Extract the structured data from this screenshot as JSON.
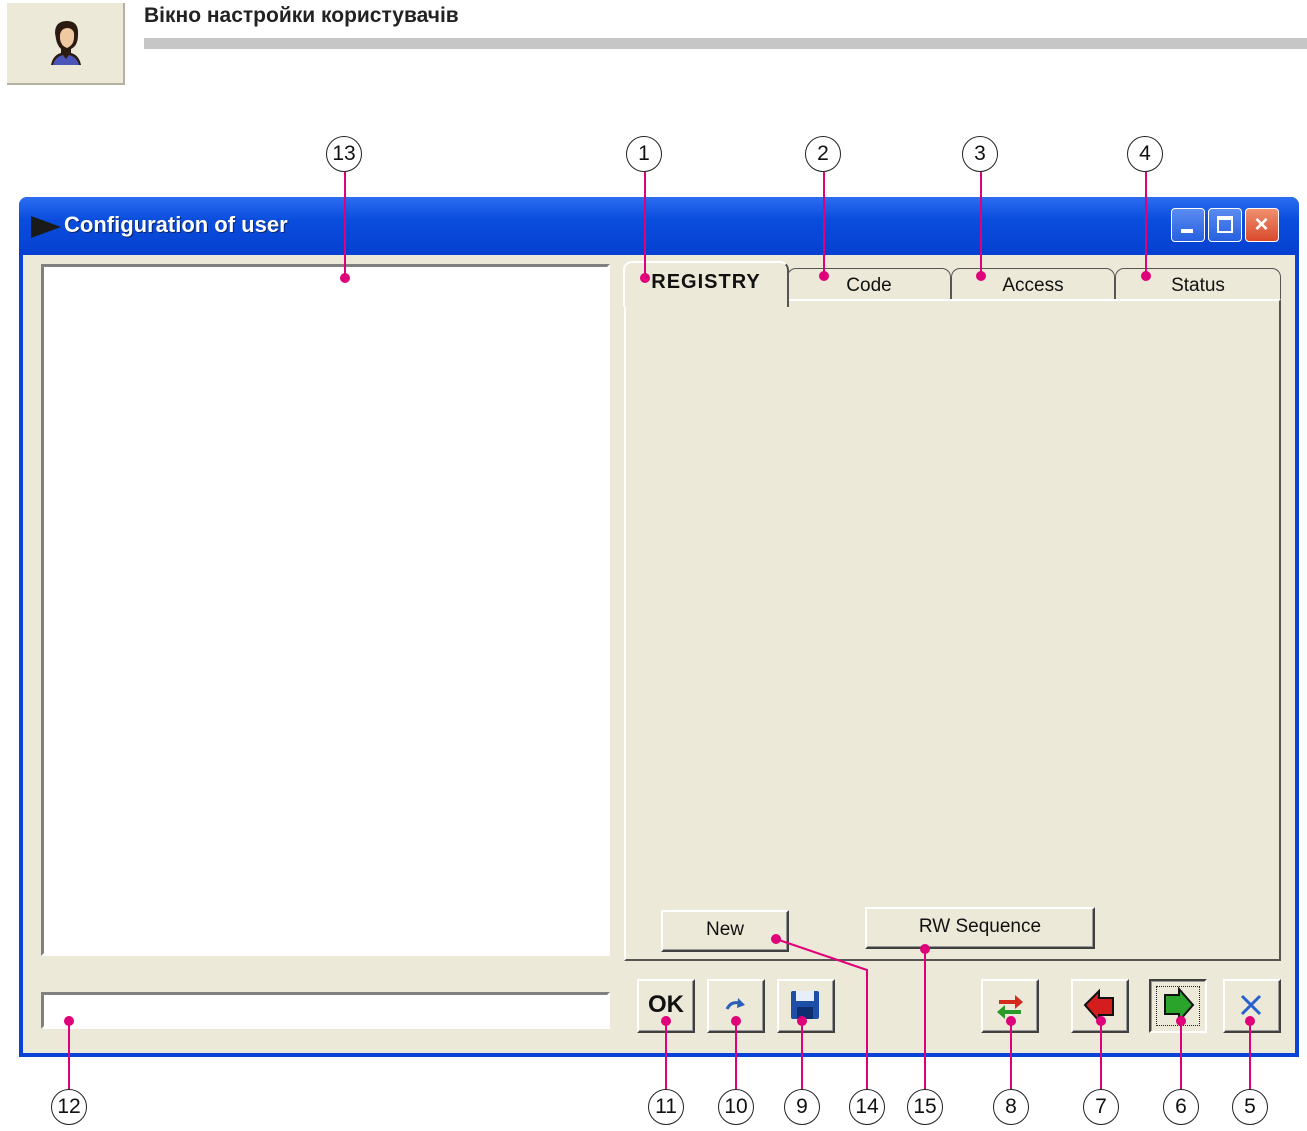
{
  "header": {
    "title": "Вікно настройки користувачів",
    "icon": "user-portrait-icon"
  },
  "window": {
    "title": "Configuration of user",
    "controls": {
      "minimize": "minimize-icon",
      "maximize": "maximize-icon",
      "close": "×"
    }
  },
  "tabs": [
    {
      "label": "REGISTRY",
      "active": true
    },
    {
      "label": "Code",
      "active": false
    },
    {
      "label": "Access",
      "active": false
    },
    {
      "label": "Status",
      "active": false
    }
  ],
  "registry_panel": {
    "new_button": "New",
    "rw_sequence_button": "RW Sequence"
  },
  "toolbar": {
    "ok_button": "OK",
    "undo_icon": "undo-arrow-icon",
    "save_icon": "floppy-disk-icon",
    "transfer_icon": "transfer-arrows-icon",
    "previous_icon": "red-left-arrow-icon",
    "next_icon": "green-right-arrow-icon",
    "cancel_icon": "blue-x-icon"
  },
  "callouts": {
    "c1": "1",
    "c2": "2",
    "c3": "3",
    "c4": "4",
    "c5": "5",
    "c6": "6",
    "c7": "7",
    "c8": "8",
    "c9": "9",
    "c10": "10",
    "c11": "11",
    "c12": "12",
    "c13": "13",
    "c14": "14",
    "c15": "15"
  },
  "colors": {
    "callout_leader": "#e0007a",
    "window_frame": "#0842d6",
    "client_background": "#ece9d8"
  }
}
